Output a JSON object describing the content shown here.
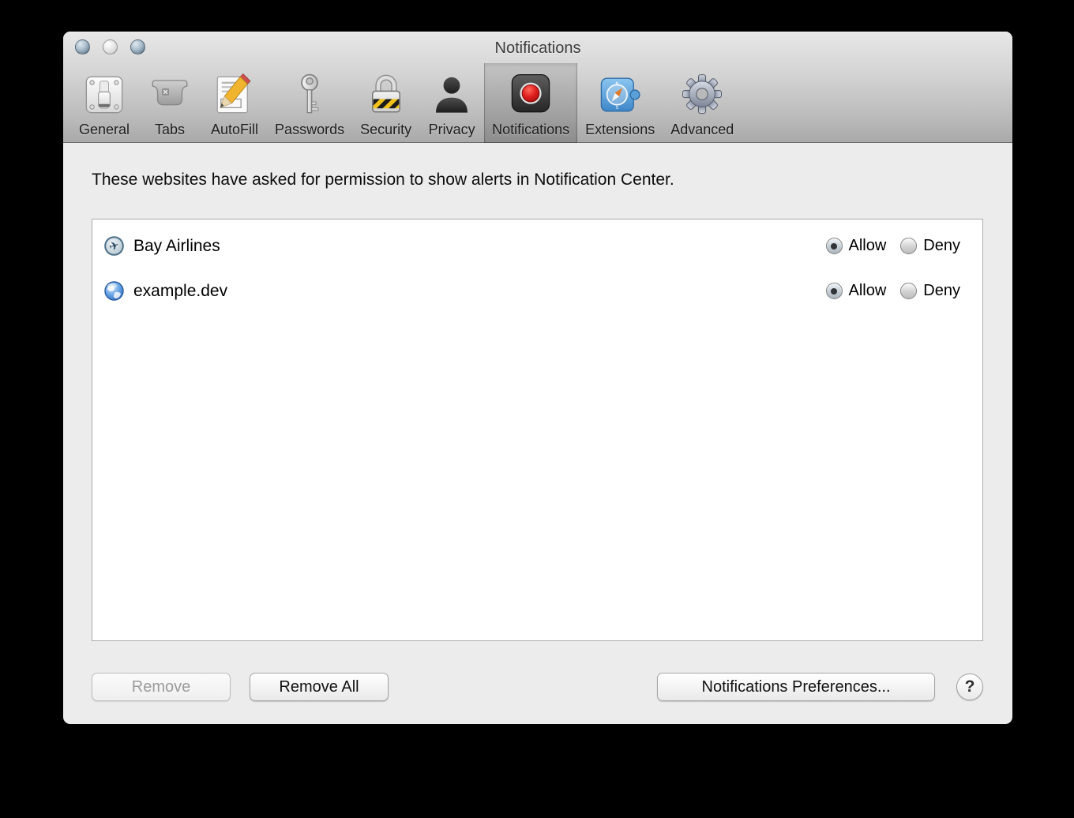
{
  "window": {
    "title": "Notifications"
  },
  "toolbar": {
    "items": [
      {
        "label": "General",
        "icon": "light-switch-icon"
      },
      {
        "label": "Tabs",
        "icon": "tab-icon"
      },
      {
        "label": "AutoFill",
        "icon": "notepad-pencil-icon"
      },
      {
        "label": "Passwords",
        "icon": "key-icon"
      },
      {
        "label": "Security",
        "icon": "padlock-icon"
      },
      {
        "label": "Privacy",
        "icon": "person-silhouette-icon"
      },
      {
        "label": "Notifications",
        "icon": "record-dot-icon",
        "selected": true
      },
      {
        "label": "Extensions",
        "icon": "puzzle-compass-icon"
      },
      {
        "label": "Advanced",
        "icon": "gear-icon"
      }
    ]
  },
  "description": "These websites have asked for permission to show alerts in Notification Center.",
  "permissions_list": {
    "rows": [
      {
        "site": "Bay Airlines",
        "icon": "airplane-icon",
        "allow_label": "Allow",
        "deny_label": "Deny",
        "selected": "allow"
      },
      {
        "site": "example.dev",
        "icon": "globe-icon",
        "allow_label": "Allow",
        "deny_label": "Deny",
        "selected": "allow"
      }
    ]
  },
  "footer": {
    "remove": "Remove",
    "remove_all": "Remove All",
    "notifications_preferences": "Notifications Preferences...",
    "help": "?"
  },
  "colors": {
    "record_red": "#d81e1e",
    "extension_blue": "#55a0e0",
    "hazard_yellow": "#f2c21a",
    "window_bg": "#ececec"
  }
}
